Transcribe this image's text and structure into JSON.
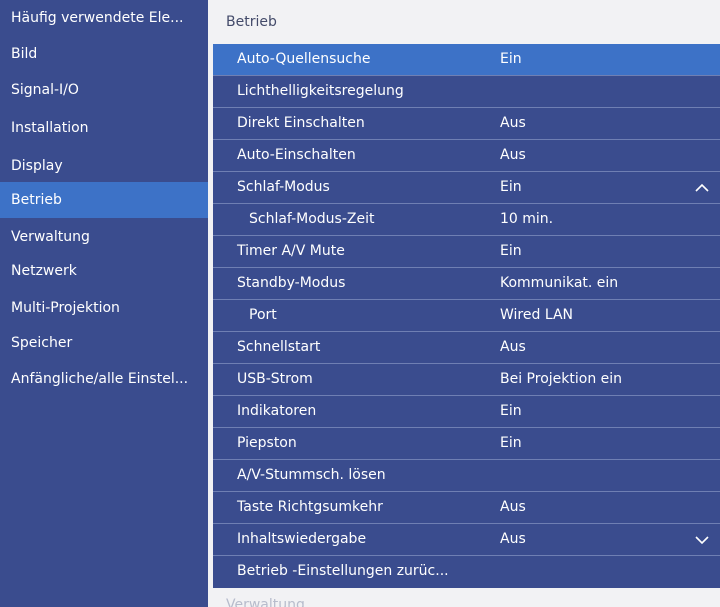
{
  "sidebar": {
    "items": [
      {
        "label": "Häufig verwendete Ele..."
      },
      {
        "label": "Bild"
      },
      {
        "label": "Signal-I/O"
      },
      {
        "label": "Installation"
      },
      {
        "label": "Display"
      },
      {
        "label": "Betrieb"
      },
      {
        "label": "Verwaltung"
      },
      {
        "label": "Netzwerk"
      },
      {
        "label": "Multi-Projektion"
      },
      {
        "label": "Speicher"
      },
      {
        "label": "Anfängliche/alle Einstel..."
      }
    ],
    "active_index": 5
  },
  "main": {
    "title": "Betrieb",
    "rows": [
      {
        "label": "Auto-Quellensuche",
        "value": "Ein"
      },
      {
        "label": "Lichthelligkeitsregelung",
        "value": ""
      },
      {
        "label": "Direkt Einschalten",
        "value": "Aus"
      },
      {
        "label": "Auto-Einschalten",
        "value": "Aus"
      },
      {
        "label": "Schlaf-Modus",
        "value": "Ein"
      },
      {
        "label": "Schlaf-Modus-Zeit",
        "value": "10 min."
      },
      {
        "label": "Timer A/V Mute",
        "value": "Ein"
      },
      {
        "label": "Standby-Modus",
        "value": "Kommunikat. ein"
      },
      {
        "label": "Port",
        "value": "Wired LAN"
      },
      {
        "label": "Schnellstart",
        "value": "Aus"
      },
      {
        "label": "USB-Strom",
        "value": "Bei Projektion ein"
      },
      {
        "label": "Indikatoren",
        "value": "Ein"
      },
      {
        "label": "Piepston",
        "value": "Ein"
      },
      {
        "label": "A/V-Stummsch. lösen",
        "value": ""
      },
      {
        "label": "Taste Richtgsumkehr",
        "value": "Aus"
      },
      {
        "label": "Inhaltswiedergabe",
        "value": "Aus"
      },
      {
        "label": "Betrieb -Einstellungen zurüc...",
        "value": ""
      }
    ],
    "selected_index": 0,
    "next_section": "Verwaltung"
  },
  "icons": {
    "collapse": "chevron-up-icon",
    "expand": "chevron-down-icon"
  },
  "colors": {
    "sidebar_bg": "#3a4c8e",
    "highlight": "#3d72c7",
    "panel_bg": "#f2f2f4"
  }
}
